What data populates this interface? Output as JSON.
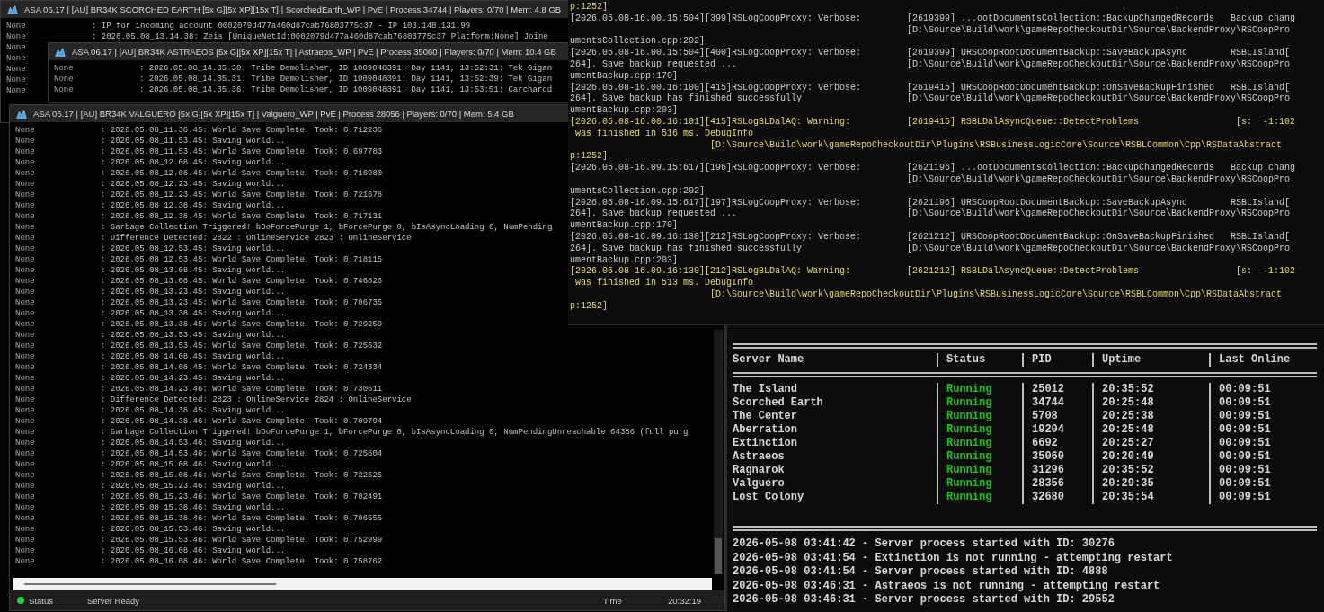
{
  "windows": [
    {
      "title": "ASA 06.17 | [AU] BR34K SCORCHED EARTH [5x G][5x XP][15x T] | ScorchedEarth_WP | PvE | Process 34744 | Players: 0/70 | Mem: 4.8 GB",
      "lines": [
        {
          "source": "None",
          "message": ": IP for incoming account 0002079d477a460d87cab76803775c37 - IP 103.148.131.99"
        },
        {
          "source": "None",
          "message": ": 2026.05.08_13.14.38: Zeis [UniqueNetId:0002079d477a460d87cab76803775c37 Platform:None] Joine"
        },
        {
          "source": "None"
        },
        {
          "source": "None"
        },
        {
          "source": "None"
        },
        {
          "source": "None"
        },
        {
          "source": "None"
        }
      ]
    },
    {
      "title": "ASA 06.17 | [AU] BR34K ASTRAEOS [5x G][5x XP][15x T] | Astraeos_WP | PvE | Process 35060 | Players: 0/70 | Mem: 10.4 GB",
      "lines": [
        {
          "source": "None",
          "message": ": 2026.05.08_14.35.30: Tribe Demolisher, ID 1009048391: Day 1141, 13:52:31: Tek Gigan"
        },
        {
          "source": "None",
          "message": ": 2026.05.08_14.35.31: Tribe Demolisher, ID 1009048391: Day 1141, 13:52:39: Tek Gigan"
        },
        {
          "source": "None",
          "message": ": 2026.05.08_14.35.36: Tribe Demolisher, ID 1009048391: Day 1141, 13:53:51: Carcharod"
        }
      ]
    },
    {
      "title": "ASA 06.17 | [AU] BR34K VALGUERO [5x G][5x XP][15x T] | Valguero_WP | PvE | Process 28056 | Players: 0/70 | Mem: 5.4 GB",
      "lines": [
        {
          "source": "None",
          "message": ": 2026.05.08_11.38.45: World Save Complete. Took: 0.712238"
        },
        {
          "source": "None",
          "message": ": 2026.05.08_11.53.45: Saving world..."
        },
        {
          "source": "None",
          "message": ": 2026.05.08_11.53.45: World Save Complete. Took: 0.697783"
        },
        {
          "source": "None",
          "message": ": 2026.05.08_12.08.45: Saving world..."
        },
        {
          "source": "None",
          "message": ": 2026.05.08_12.08.45: World Save Complete. Took: 0.716980"
        },
        {
          "source": "None",
          "message": ": 2026.05.08_12.23.45: Saving world..."
        },
        {
          "source": "None",
          "message": ": 2026.05.08_12.23.45: World Save Complete. Took: 0.721678"
        },
        {
          "source": "None",
          "message": ": 2026.05.08_12.38.45: Saving world..."
        },
        {
          "source": "None",
          "message": ": 2026.05.08_12.38.45: World Save Complete. Took: 0.717131"
        },
        {
          "source": "None",
          "message": ": Garbage Collection Triggered! bDoForcePurge 1, bForcePurge 0, bIsAsyncLoading 0, NumPending"
        },
        {
          "source": "None",
          "message": ": Difference Detected: 2822 : OnlineService 2823 : OnlineService"
        },
        {
          "source": "None",
          "message": ": 2026.05.08_12.53.45: Saving world..."
        },
        {
          "source": "None",
          "message": ": 2026.05.08_12.53.45: World Save Complete. Took: 0.718115"
        },
        {
          "source": "None",
          "message": ": 2026.05.08_13.08.45: Saving world..."
        },
        {
          "source": "None",
          "message": ": 2026.05.08_13.08.45: World Save Complete. Took: 0.746826"
        },
        {
          "source": "None",
          "message": ": 2026.05.08_13.23.45: Saving world..."
        },
        {
          "source": "None",
          "message": ": 2026.05.08_13.23.45: World Save Complete. Took: 0.706735"
        },
        {
          "source": "None",
          "message": ": 2026.05.08_13.38.45: Saving world..."
        },
        {
          "source": "None",
          "message": ": 2026.05.08_13.38.45: World Save Complete. Took: 0.729259"
        },
        {
          "source": "None",
          "message": ": 2026.05.08_13.53.45: Saving world..."
        },
        {
          "source": "None",
          "message": ": 2026.05.08_13.53.45: World Save Complete. Took: 0.725632"
        },
        {
          "source": "None",
          "message": ": 2026.05.08_14.08.45: Saving world..."
        },
        {
          "source": "None",
          "message": ": 2026.05.08_14.08.45: World Save Complete. Took: 0.724334"
        },
        {
          "source": "None",
          "message": ": 2026.05.08_14.23.45: Saving world..."
        },
        {
          "source": "None",
          "message": ": 2026.05.08_14.23.46: World Save Complete. Took: 0.730611"
        },
        {
          "source": "None",
          "message": ": Difference Detected: 2823 : OnlineService 2824 : OnlineService"
        },
        {
          "source": "None",
          "message": ": 2026.05.08_14.38.45: Saving world..."
        },
        {
          "source": "None",
          "message": ": 2026.05.08_14.38.46: World Save Complete. Took: 0.709794"
        },
        {
          "source": "None",
          "message": ": Garbage Collection Triggered! bDoForcePurge 1, bForcePurge 0, bIsAsyncLoading 0, NumPendingUnreachable 64386 (full purg"
        },
        {
          "source": "None",
          "message": ": 2026.05.08_14.53.46: Saving world..."
        },
        {
          "source": "None",
          "message": ": 2026.05.08_14.53.46: World Save Complete. Took: 0.725804"
        },
        {
          "source": "None",
          "message": ": 2026.05.08_15.08.46: Saving world..."
        },
        {
          "source": "None",
          "message": ": 2026.05.08_15.08.46: World Save Complete. Took: 0.722525"
        },
        {
          "source": "None",
          "message": ": 2026.05.08_15.23.46: Saving world..."
        },
        {
          "source": "None",
          "message": ": 2026.05.08_15.23.46: World Save Complete. Took: 0.702491"
        },
        {
          "source": "None",
          "message": ": 2026.05.08_15.38.46: Saving world..."
        },
        {
          "source": "None",
          "message": ": 2026.05.08_15.38.46: World Save Complete. Took: 0.706555"
        },
        {
          "source": "None",
          "message": ": 2026.05.08_15.53.46: Saving world..."
        },
        {
          "source": "None",
          "message": ": 2026.05.08_15.53.46: World Save Complete. Took: 0.752999"
        },
        {
          "source": "None",
          "message": ": 2026.05.08_16.08.46: Saving world..."
        },
        {
          "source": "None",
          "message": ": 2026.05.08_16.08.46: World Save Complete. Took: 0.758762"
        }
      ],
      "status_bar": {
        "status_label": "Status",
        "status_text": "Server Ready",
        "time_label": "Time",
        "time": "20:32:19"
      }
    }
  ],
  "log_console": {
    "lines": [
      {
        "kind": "warning",
        "text": "p:1252]"
      },
      {
        "kind": "verbose",
        "text": "[2026.05.08-16.00.15:504][399]RSLogCoopProxy: Verbose:",
        "detail": "[2619399] ...ootDocumentsCollection::BackupChangedRecords   Backup chang"
      },
      {
        "kind": "verbose",
        "detail": "[D:\\Source\\Build\\work\\gameRepoCheckoutDir\\Source\\BackendProxy\\RSCoopPro"
      },
      {
        "kind": "verbose",
        "text": "umentsCollection.cpp:202]"
      },
      {
        "kind": "verbose",
        "text": "[2026.05.08-16.00.15:504][400]RSLogCoopProxy: Verbose:",
        "detail": "[2619399] URSCoopRootDocumentBackup::SaveBackupAsync        RSBLIsland["
      },
      {
        "kind": "verbose",
        "text": "264]. Save backup requested ...",
        "detail": "[D:\\Source\\Build\\work\\gameRepoCheckoutDir\\Source\\BackendProxy\\RSCoopPro"
      },
      {
        "kind": "verbose",
        "text": "umentBackup.cpp:170]"
      },
      {
        "kind": "verbose",
        "text": "[2026.05.08-16.00.16:100][415]RSLogCoopProxy: Verbose:",
        "detail": "[2619415] URSCoopRootDocumentBackup::OnSaveBackupFinished   RSBLIsland["
      },
      {
        "kind": "verbose",
        "text": "264]. Save backup has finished successfully",
        "detail": "[D:\\Source\\Build\\work\\gameRepoCheckoutDir\\Source\\BackendProxy\\RSCoopPro"
      },
      {
        "kind": "verbose",
        "text": "umentBackup.cpp:203]"
      },
      {
        "kind": "warning",
        "text": "[2026.05.08-16.00.16:101][415]RSLogBLDalAQ: Warning:",
        "detail": "[2619415] RSBLDalAsyncQueue::DetectProblems                  [s:  -1:102"
      },
      {
        "kind": "warning",
        "text": " was finished in 516 ms. DebugInfo"
      },
      {
        "kind": "warning",
        "continuation": "[D:\\Source\\Build\\work\\gameRepoCheckoutDir\\Plugins\\RSBusinessLogicCore\\Source\\RSBLCommon\\Cpp\\RSDataAbstract"
      },
      {
        "kind": "warning",
        "text": "p:1252]"
      },
      {
        "kind": "verbose",
        "text": "[2026.05.08-16.09.15:617][196]RSLogCoopProxy: Verbose:",
        "detail": "[2621196] ...ootDocumentsCollection::BackupChangedRecords   Backup chang"
      },
      {
        "kind": "verbose",
        "detail": "[D:\\Source\\Build\\work\\gameRepoCheckoutDir\\Source\\BackendProxy\\RSCoopPro"
      },
      {
        "kind": "verbose",
        "text": "umentsCollection.cpp:202]"
      },
      {
        "kind": "verbose",
        "text": "[2026.05.08-16.09.15:617][197]RSLogCoopProxy: Verbose:",
        "detail": "[2621196] URSCoopRootDocumentBackup::SaveBackupAsync        RSBLIsland["
      },
      {
        "kind": "verbose",
        "text": "264]. Save backup requested ...",
        "detail": "[D:\\Source\\Build\\work\\gameRepoCheckoutDir\\Source\\BackendProxy\\RSCoopPro"
      },
      {
        "kind": "verbose",
        "text": "umentBackup.cpp:170]"
      },
      {
        "kind": "verbose",
        "text": "[2026.05.08-16.09.16:130][212]RSLogCoopProxy: Verbose:",
        "detail": "[2621212] URSCoopRootDocumentBackup::OnSaveBackupFinished   RSBLIsland["
      },
      {
        "kind": "verbose",
        "text": "264]. Save backup has finished successfully",
        "detail": "[D:\\Source\\Build\\work\\gameRepoCheckoutDir\\Source\\BackendProxy\\RSCoopPro"
      },
      {
        "kind": "verbose",
        "text": "umentBackup.cpp:203]"
      },
      {
        "kind": "warning",
        "text": "[2026.05.08-16.09.16:130][212]RSLogBLDalAQ: Warning:",
        "detail": "[2621212] RSBLDalAsyncQueue::DetectProblems                  [s:  -1:102"
      },
      {
        "kind": "warning",
        "text": " was finished in 513 ms. DebugInfo"
      },
      {
        "kind": "warning",
        "continuation": "[D:\\Source\\Build\\work\\gameRepoCheckoutDir\\Plugins\\RSBusinessLogicCore\\Source\\RSBLCommon\\Cpp\\RSDataAbstract"
      },
      {
        "kind": "warning",
        "text": "p:1252]"
      }
    ]
  },
  "server_table": {
    "columns": [
      "Server Name",
      "Status",
      "PID",
      "Uptime",
      "Last Online"
    ],
    "rows": [
      {
        "name": "The Island",
        "status": "Running",
        "pid": "25012",
        "uptime": "20:35:52",
        "last_online": "00:09:51"
      },
      {
        "name": "Scorched Earth",
        "status": "Running",
        "pid": "34744",
        "uptime": "20:25:48",
        "last_online": "00:09:51"
      },
      {
        "name": "The Center",
        "status": "Running",
        "pid": "5708",
        "uptime": "20:25:38",
        "last_online": "00:09:51"
      },
      {
        "name": "Aberration",
        "status": "Running",
        "pid": "19204",
        "uptime": "20:25:48",
        "last_online": "00:09:51"
      },
      {
        "name": "Extinction",
        "status": "Running",
        "pid": "6692",
        "uptime": "20:25:27",
        "last_online": "00:09:51"
      },
      {
        "name": "Astraeos",
        "status": "Running",
        "pid": "35060",
        "uptime": "20:20:49",
        "last_online": "00:09:51"
      },
      {
        "name": "Ragnarok",
        "status": "Running",
        "pid": "31296",
        "uptime": "20:35:52",
        "last_online": "00:09:51"
      },
      {
        "name": "Valguero",
        "status": "Running",
        "pid": "28356",
        "uptime": "20:29:35",
        "last_online": "00:09:51"
      },
      {
        "name": "Lost Colony",
        "status": "Running",
        "pid": "32680",
        "uptime": "20:35:54",
        "last_online": "00:09:51"
      }
    ]
  },
  "events": [
    "2026-05-08 03:41:42 - Server process started with ID: 30276",
    "2026-05-08 03:41:54 - Extinction is not running - attempting restart",
    "2026-05-08 03:41:54 - Server process started with ID: 4888",
    "2026-05-08 03:46:31 - Astraeos is not running - attempting restart",
    "2026-05-08 03:46:31 - Server process started with ID: 29552"
  ]
}
